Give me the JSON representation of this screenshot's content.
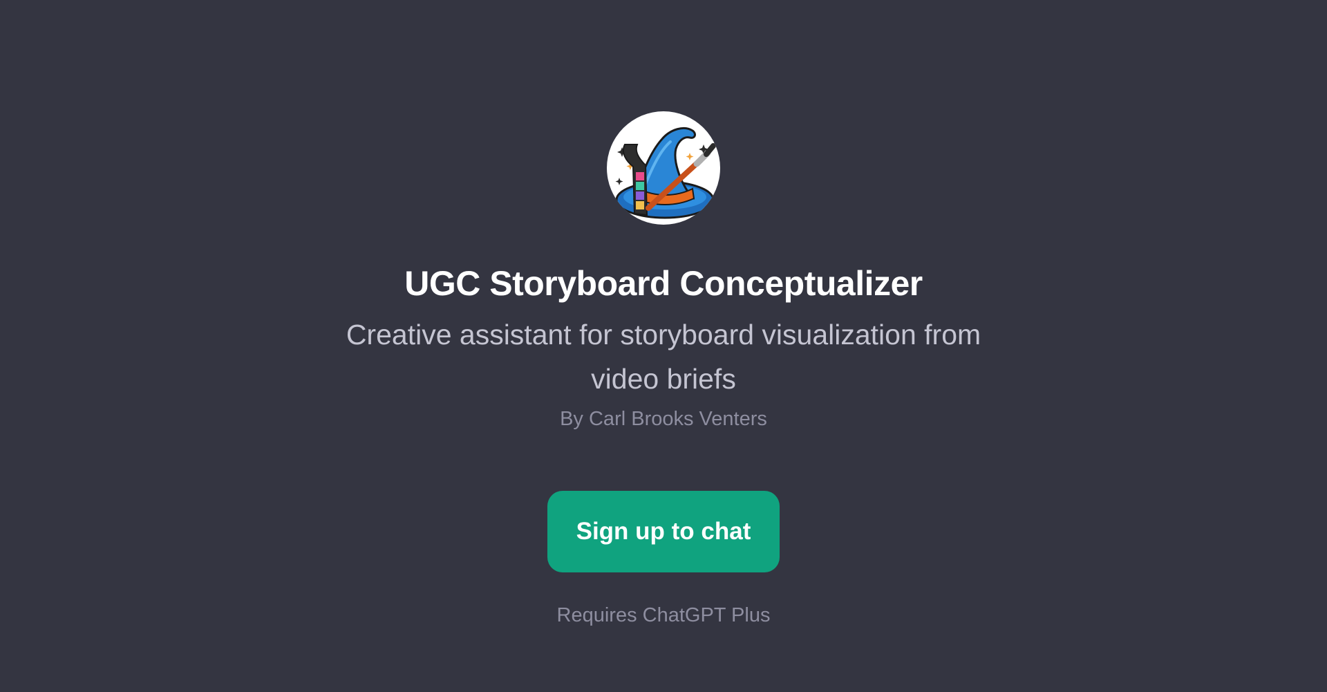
{
  "gpt": {
    "avatar_icon": "wizard-hat-film-brush-icon",
    "title": "UGC Storyboard Conceptualizer",
    "description": "Creative assistant for storyboard visualization from video briefs",
    "author": "By Carl Brooks Venters"
  },
  "actions": {
    "signup_label": "Sign up to chat",
    "requirement": "Requires ChatGPT Plus"
  },
  "colors": {
    "background": "#343541",
    "title": "#ffffff",
    "description": "#c5c5d2",
    "muted": "#8e8ea0",
    "accent": "#10a37f"
  }
}
